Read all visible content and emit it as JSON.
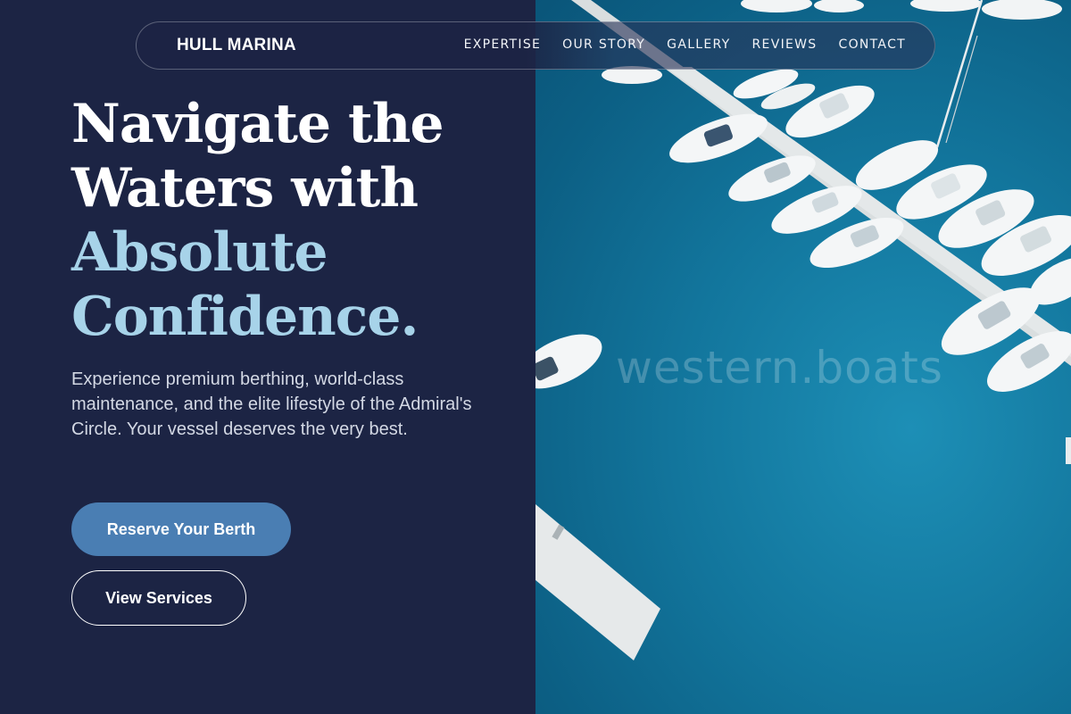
{
  "brand": {
    "name": "HULL MARINA"
  },
  "nav": {
    "items": [
      {
        "label": "EXPERTISE"
      },
      {
        "label": "OUR STORY"
      },
      {
        "label": "GALLERY"
      },
      {
        "label": "REVIEWS"
      },
      {
        "label": "CONTACT"
      }
    ]
  },
  "hero": {
    "headline_lines": [
      "Navigate the",
      "Waters with"
    ],
    "headline_accent_lines": [
      "Absolute",
      "Confidence."
    ],
    "tagline": "Experience premium berthing, world-class maintenance, and the elite lifestyle of the Admiral's Circle. Your vessel deserves the very best.",
    "primary_cta": "Reserve Your Berth",
    "secondary_cta": "View Services"
  },
  "photo": {
    "watermark": "western.boats",
    "colors": {
      "water": "#12759c",
      "dock": "#dfe3e4",
      "boat": "#f4f6f7"
    }
  },
  "colors": {
    "background": "#1c2444",
    "accent_text": "#a7d3e9",
    "primary_button": "#4a7eb3"
  }
}
